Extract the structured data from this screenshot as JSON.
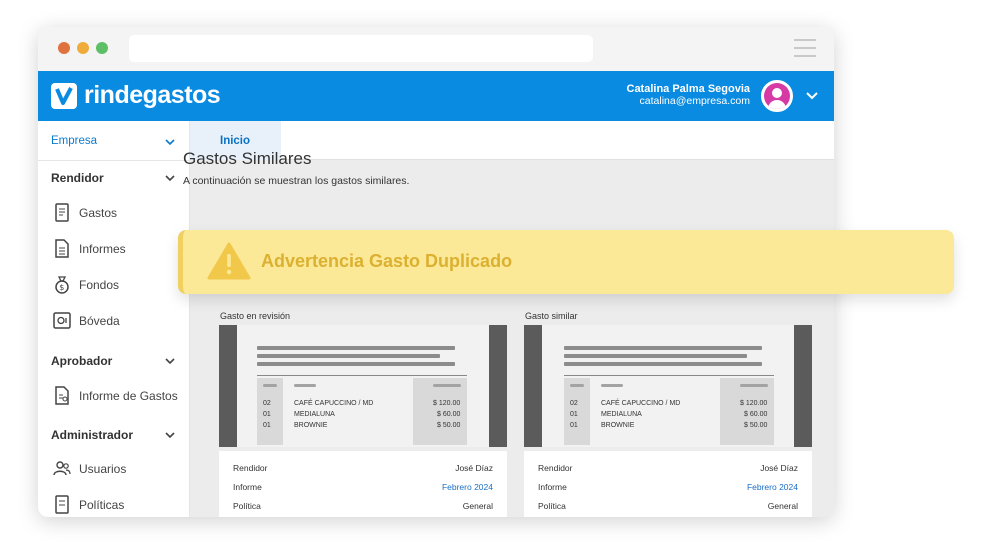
{
  "app": {
    "brand": "rindegastos",
    "user_name": "Catalina Palma Segovia",
    "user_email": "catalina@empresa.com"
  },
  "sidebar": {
    "company": "Empresa",
    "sections": {
      "rendidor": "Rendidor",
      "aprobador": "Aprobador",
      "administrador": "Administrador"
    },
    "items": {
      "gastos": "Gastos",
      "informes": "Informes",
      "fondos": "Fondos",
      "boveda": "Bóveda",
      "informe_gastos": "Informe de Gastos",
      "usuarios": "Usuarios",
      "politicas": "Políticas"
    }
  },
  "tabs": {
    "inicio": "Inicio"
  },
  "main": {
    "title": "Gastos Similares",
    "subtitle": "A continuación se muestran los gastos similares.",
    "left_label": "Gasto en revisión",
    "right_label": "Gasto similar"
  },
  "warning": {
    "text": "Advertencia Gasto Duplicado"
  },
  "receipt_lines": [
    {
      "qty": "02",
      "desc": "CAFÉ CAPUCCINO / MD",
      "price": "$ 120.00"
    },
    {
      "qty": "01",
      "desc": "MEDIALUNA",
      "price": "$ 60.00"
    },
    {
      "qty": "01",
      "desc": "BROWNIE",
      "price": "$ 50.00"
    }
  ],
  "details": {
    "rendidor_label": "Rendidor",
    "rendidor_value": "José Díaz",
    "informe_label": "Informe",
    "informe_value": "Febrero 2024",
    "politica_label": "Política",
    "politica_value": "General"
  },
  "colors": {
    "brand_blue": "#0a8be2",
    "warning_bg": "#fbe998",
    "warning_text": "#dcb030",
    "link": "#1a6ec7"
  }
}
